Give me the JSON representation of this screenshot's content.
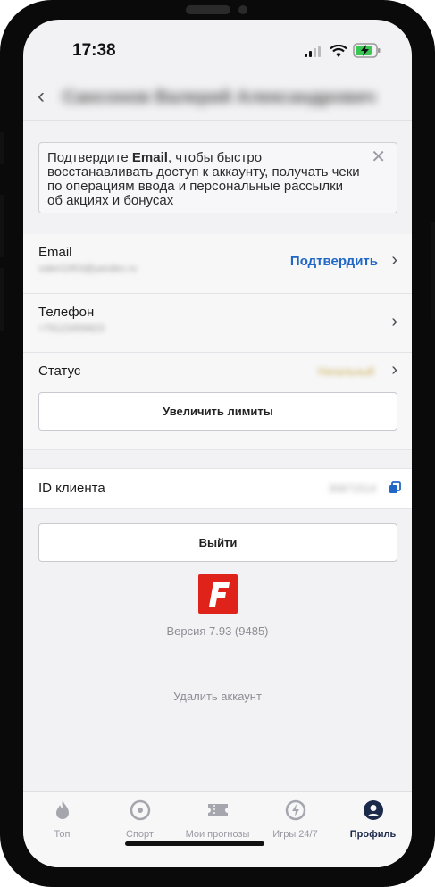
{
  "status_bar": {
    "time": "17:38"
  },
  "header": {
    "back_icon": "chevron-left-icon",
    "title": "Сансонов Валерий Александрович"
  },
  "notice": {
    "text_before": "Подтвердите ",
    "text_bold": "Email",
    "text_after": ", чтобы быстро восстанавливать доступ к аккаунту, получать чеки по операциям ввода и персональные рассылки об акциях и бонусах"
  },
  "email": {
    "label": "Email",
    "value": "valeri1953@yandex.ru",
    "action": "Подтвердить"
  },
  "phone": {
    "label": "Телефон",
    "value": "+79123456823"
  },
  "status": {
    "label": "Статус",
    "value": "Начальный"
  },
  "limits_button": "Увеличить лимиты",
  "client_id": {
    "label": "ID клиента",
    "value": "30871514"
  },
  "logout_button": "Выйти",
  "version": "Версия 7.93 (9485)",
  "delete_account": "Удалить аккаунт",
  "tabs": [
    {
      "label": "Топ",
      "icon": "flame-icon"
    },
    {
      "label": "Спорт",
      "icon": "target-icon"
    },
    {
      "label": "Мои прогнозы",
      "icon": "ticket-icon"
    },
    {
      "label": "Игры 24/7",
      "icon": "bolt-icon"
    },
    {
      "label": "Профиль",
      "icon": "user-icon"
    }
  ],
  "colors": {
    "accent": "#2167c5",
    "brand": "#e0231a",
    "tab_active": "#1b2a4a"
  }
}
